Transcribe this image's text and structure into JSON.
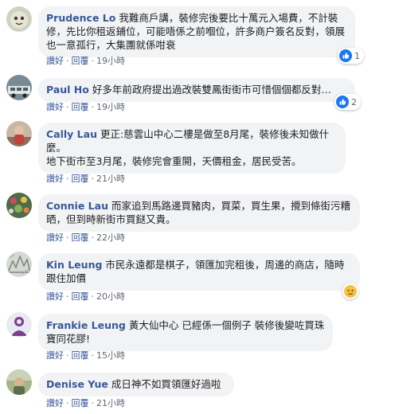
{
  "labels": {
    "like": "讚好",
    "reply": "回覆",
    "dot": "·"
  },
  "colors": {
    "author": "#385898",
    "bubble": "#f2f3f5",
    "like_blue": "#1877f2"
  },
  "comments": [
    {
      "author": "Prudence Lo",
      "text": "我難商戶講，裝修完後要比十萬元入場費，不計裝修，先比你租返鋪位，可能唔係之前嗰位，許多商户簽名反對，領展也一意孤行，大集團就係咁衰",
      "time": "19小時",
      "reaction": {
        "icon": "like-icon",
        "count": "1"
      }
    },
    {
      "author": "Paul Ho",
      "text": "好多年前政府提出過改裝雙鳳街街市可惜個個都反對…",
      "time": "19小時",
      "reaction": {
        "icon": "like-icon",
        "count": "2"
      }
    },
    {
      "author": "Cally Lau",
      "text": "更正:慈雲山中心二樓是做至8月尾，裝修後未知做什麼。\n地下街市至3月尾，裝修完會重開，天價租金，居民受苦。",
      "time": "21小時",
      "reaction": null
    },
    {
      "author": "Connie Lau",
      "text": "而家追到馬路邊買豬肉，買菜，買生果，攪到條街污糟晒，但到時新街市買餸又貴。",
      "time": "22小時",
      "reaction": null
    },
    {
      "author": "Kin Leung",
      "text": "市民永遠都是棋子，領匯加完租後，周邊的商店，隨時跟住加價",
      "time": "20小時",
      "reaction": {
        "icon": "sad-face-icon",
        "count": ""
      }
    },
    {
      "author": "Frankie Leung",
      "text": "黃大仙中心 已經係一個例子 裝修後變咗買珠寶同花膠!",
      "time": "15小時",
      "reaction": null
    },
    {
      "author": "Denise Yue",
      "text": "成日神不如買領匯好過啦",
      "time": "21小時",
      "reaction": null
    }
  ]
}
